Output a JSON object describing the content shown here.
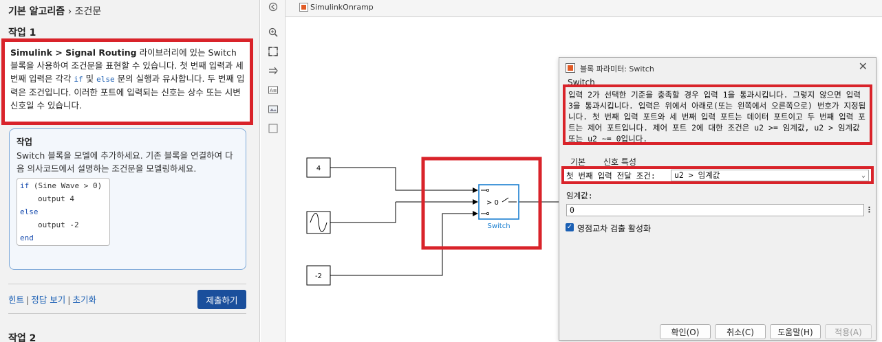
{
  "left_panel": {
    "breadcrumb_bold": "기본 알고리즘",
    "breadcrumb_sep": "›",
    "breadcrumb_current": "조건문",
    "task1_title": "작업 1",
    "desc_bold": "Simulink > Signal Routing",
    "desc_part1": " 라이브러리에 있는 Switch 블록을 사용하여 조건문을 표현할 수 있습니다. 첫 번째 입력과 세 번째 입력은 각각 ",
    "desc_code_if": "if",
    "desc_part2": " 및 ",
    "desc_code_else": "else",
    "desc_part3": " 문의 실행과 유사합니다. 두 번째 입력은 조건입니다. 이러한 포트에 입력되는 신호는 상수 또는 시변 신호일 수 있습니다.",
    "task_card": {
      "title": "작업",
      "text": "Switch 블록을 모델에 추가하세요. 기존 블록을 연결하여 다음 의사코드에서 설명하는 조건문을 모델링하세요.",
      "code": {
        "line1_kw": "if",
        "line1_rest": " (Sine Wave > 0)",
        "line2": "output 4",
        "line3_kw": "else",
        "line4": "output -2",
        "line5_kw": "end"
      }
    },
    "links": {
      "hint": "힌트",
      "answer": "정답 보기",
      "reset": "초기화"
    },
    "submit_label": "제출하기",
    "task2_title": "작업 2"
  },
  "simulink": {
    "tab_title": "SimulinkOnramp",
    "blocks": {
      "const1_value": "4",
      "const2_value": "-2",
      "switch_condition": "> 0",
      "switch_label": "Switch"
    }
  },
  "dialog": {
    "title": "블록 파라미터: Switch",
    "block_name": "Switch",
    "description": "입력 2가 선택한 기준을 충족할 경우 입력 1을 통과시킵니다. 그렇지 않으면 입력 3을 통과시킵니다. 입력은 위에서 아래로(또는 왼쪽에서 오른쪽으로) 번호가 지정됩니다. 첫 번째 입력 포트와 세 번째 입력 포트는 데이터 포트이고 두 번째 입력 포트는 제어 포트입니다. 제어 포트 2에 대한 조건은 u2 >= 임계값, u2 > 임계값 또는 u2 ~= 0입니다.",
    "tabs": [
      "기본",
      "신호 특성"
    ],
    "criteria_label": "첫 번째 입력 전달 조건:",
    "criteria_value": "u2 > 임계값",
    "threshold_label": "임계값:",
    "threshold_value": "0",
    "zero_crossing_label": "영점교차 검출 활성화",
    "zero_crossing_checked": true,
    "buttons": {
      "ok": "확인(O)",
      "cancel": "취소(C)",
      "help": "도움말(H)",
      "apply": "적용(A)"
    }
  },
  "colors": {
    "highlight_red": "#d9232a",
    "link_blue": "#1a5fb4",
    "submit_blue": "#1a4f9c",
    "simulink_blue": "#1a7fd0"
  },
  "icons": {
    "toolbar": [
      "back-arrow-icon",
      "zoom-icon",
      "fit-view-icon",
      "arrow-icon",
      "annotation-icon",
      "image-icon",
      "area-icon"
    ],
    "sine_wave_block": "sine-wave-icon"
  }
}
